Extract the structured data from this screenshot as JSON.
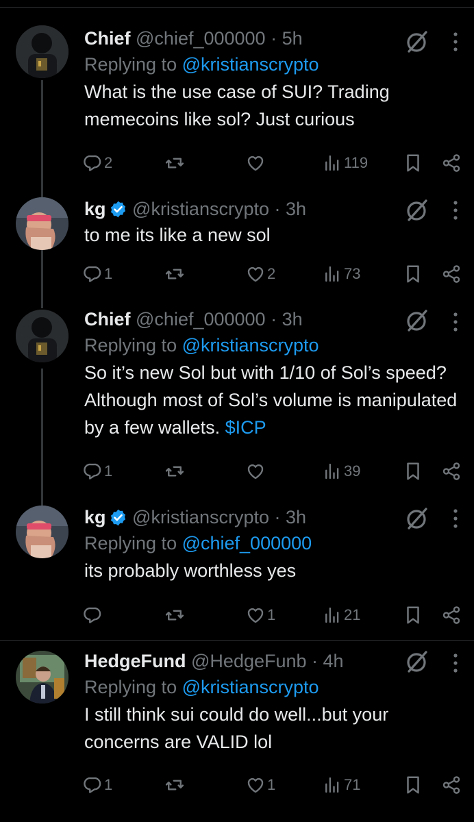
{
  "tweets": [
    {
      "name": "Chief",
      "handle": "@chief_000000",
      "time": "5h",
      "verified": false,
      "replying_prefix": "Replying to ",
      "replying_to": "@kristianscrypto",
      "text": "What is the use case of SUI? Trading memecoins like sol? Just curious",
      "text_link": "",
      "replies": "2",
      "reposts": "",
      "likes": "",
      "views": "119"
    },
    {
      "name": "kg",
      "handle": "@kristianscrypto",
      "time": "3h",
      "verified": true,
      "replying_prefix": "",
      "replying_to": "",
      "text": "to me its like a new sol",
      "text_link": "",
      "replies": "1",
      "reposts": "",
      "likes": "2",
      "views": "73"
    },
    {
      "name": "Chief",
      "handle": "@chief_000000",
      "time": "3h",
      "verified": false,
      "replying_prefix": "Replying to ",
      "replying_to": "@kristianscrypto",
      "text": "So it’s new Sol but with 1/10 of Sol’s speed? Although most of Sol’s volume is manipulated by a few wallets. ",
      "text_link": "$ICP",
      "replies": "1",
      "reposts": "",
      "likes": "",
      "views": "39"
    },
    {
      "name": "kg",
      "handle": "@kristianscrypto",
      "time": "3h",
      "verified": true,
      "replying_prefix": "Replying to ",
      "replying_to": "@chief_000000",
      "text": "its probably worthless yes",
      "text_link": "",
      "replies": "",
      "reposts": "",
      "likes": "1",
      "views": "21"
    },
    {
      "name": "HedgeFund",
      "handle": "@HedgeFunb",
      "time": "4h",
      "verified": false,
      "replying_prefix": "Replying to ",
      "replying_to": "@kristianscrypto",
      "text": "I still think sui could do well...but your concerns are VALID lol",
      "text_link": "",
      "replies": "1",
      "reposts": "",
      "likes": "1",
      "views": "71"
    }
  ],
  "separator": " · ",
  "colors": {
    "background": "#000000",
    "text": "#e7e9ea",
    "muted": "#71767b",
    "accent": "#1d9bf0",
    "divider": "#2f3336"
  },
  "icons": {
    "reply": "reply-icon",
    "repost": "repost-icon",
    "like": "like-icon",
    "views": "views-icon",
    "bookmark": "bookmark-icon",
    "share": "share-icon",
    "grok": "grok-icon",
    "more": "more-icon",
    "verified": "verified-badge-icon"
  }
}
